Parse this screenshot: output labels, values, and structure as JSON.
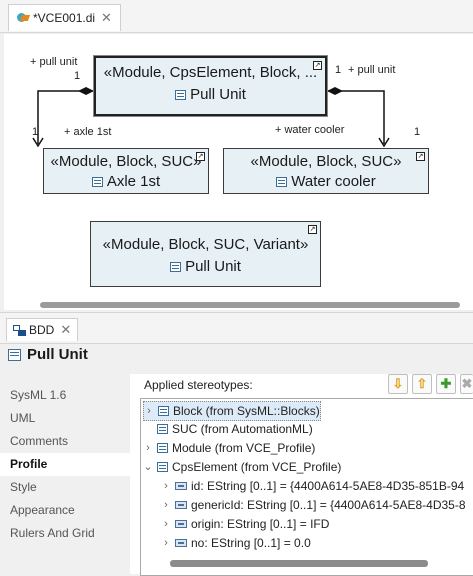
{
  "editor": {
    "tab_title": "*VCE001.di",
    "close_glyph": "✕"
  },
  "diagram": {
    "nodes": [
      {
        "stereotypes": "«Module, CpsElement, Block, ...",
        "name": "Pull Unit"
      },
      {
        "stereotypes": "«Module, Block, SUC»",
        "name": "Axle 1st"
      },
      {
        "stereotypes": "«Module, Block, SUC»",
        "name": "Water cooler"
      },
      {
        "stereotypes": "«Module, Block, SUC, Variant»",
        "name": "Pull Unit"
      }
    ],
    "labels": {
      "left_role": "+ pull unit",
      "left_mult": "1",
      "right_role": "+ pull unit",
      "right_mult": "1",
      "axle_mult": "1",
      "axle_role": "+ axle 1st",
      "cooler_role": "+ water cooler",
      "cooler_mult": "1"
    }
  },
  "view": {
    "tab_title": "BDD",
    "close_glyph": "✕",
    "title": "Pull Unit"
  },
  "sidebar": {
    "items": [
      {
        "label": "SysML 1.6",
        "active": false
      },
      {
        "label": "UML",
        "active": false
      },
      {
        "label": "Comments",
        "active": false
      },
      {
        "label": "Profile",
        "active": true
      },
      {
        "label": "Style",
        "active": false
      },
      {
        "label": "Appearance",
        "active": false
      },
      {
        "label": "Rulers And Grid",
        "active": false
      }
    ]
  },
  "stereotypes_panel": {
    "label": "Applied stereotypes:",
    "buttons": [
      {
        "name": "move-down",
        "glyph": "⇩",
        "color": "#e0a01a"
      },
      {
        "name": "move-up",
        "glyph": "⇧",
        "color": "#e0a01a"
      },
      {
        "name": "add",
        "glyph": "✚",
        "color": "#3a9a2a"
      },
      {
        "name": "remove",
        "glyph": "✖",
        "color": "#aaaaaa"
      }
    ],
    "tree": [
      {
        "twisty": "›",
        "icon": "class",
        "text": "Block   (from SysML::Blocks)",
        "selected": true
      },
      {
        "twisty": "",
        "icon": "class",
        "text": "SUC   (from AutomationML)",
        "selected": false
      },
      {
        "twisty": "›",
        "icon": "class",
        "text": "Module   (from VCE_Profile)",
        "selected": false
      },
      {
        "twisty": "⌄",
        "icon": "class",
        "text": "CpsElement   (from VCE_Profile)",
        "selected": false
      },
      {
        "twisty": "›",
        "icon": "attr",
        "text": "id: EString [0..1] = {4400A614-5AE8-4D35-851B-94",
        "selected": false
      },
      {
        "twisty": "›",
        "icon": "attr",
        "text": "genericId: EString [0..1] = {4400A614-5AE8-4D35-8",
        "selected": false
      },
      {
        "twisty": "›",
        "icon": "attr",
        "text": "origin: EString [0..1] = IFD",
        "selected": false
      },
      {
        "twisty": "›",
        "icon": "attr",
        "text": "no: EString [0..1] = 0.0",
        "selected": false
      }
    ]
  }
}
